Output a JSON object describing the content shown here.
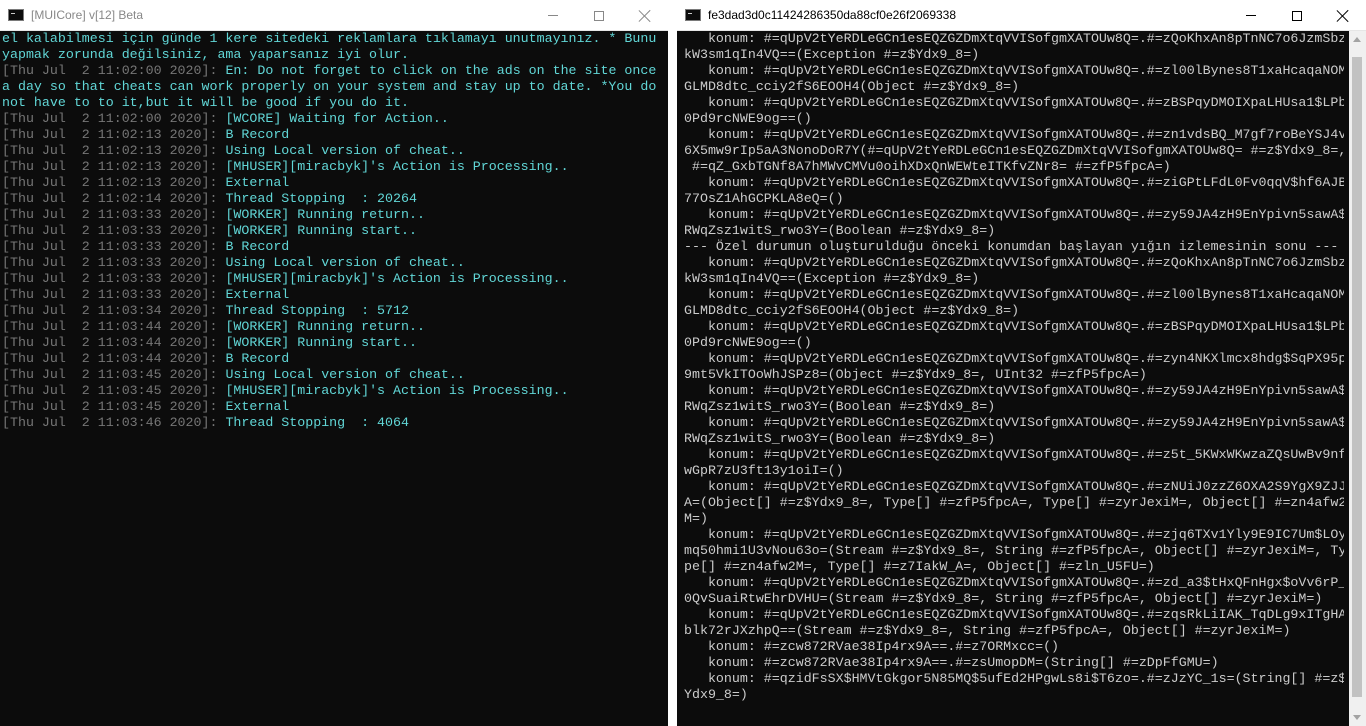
{
  "left_window": {
    "title": "[MUICore] v[12] Beta",
    "colors": {
      "timestamp": "#767676",
      "message": "#61d6d6",
      "background": "#0c0c0c"
    },
    "lines": [
      {
        "ts": "",
        "msg": "el kalabilmesi için günde 1 kere sitedeki reklamlara tıklamayı unutmayınız. * Bunu"
      },
      {
        "ts": "",
        "msg": "yapmak zorunda değilsiniz, ama yaparsanız iyi olur."
      },
      {
        "ts": "[Thu Jul  2 11:02:00 2020]: ",
        "msg": "En: Do not forget to click on the ads on the site once"
      },
      {
        "ts": "",
        "msg": "a day so that cheats can work properly on your system and stay up to date. *You do"
      },
      {
        "ts": "",
        "msg": "not have to to it,but it will be good if you do it."
      },
      {
        "ts": "[Thu Jul  2 11:02:00 2020]: ",
        "msg": "[WCORE] Waiting for Action.."
      },
      {
        "ts": "[Thu Jul  2 11:02:13 2020]: ",
        "msg": "B Record"
      },
      {
        "ts": "[Thu Jul  2 11:02:13 2020]: ",
        "msg": "Using Local version of cheat.."
      },
      {
        "ts": "[Thu Jul  2 11:02:13 2020]: ",
        "msg": "[MHUSER][miracbyk]'s Action is Processing.."
      },
      {
        "ts": "[Thu Jul  2 11:02:13 2020]: ",
        "msg": "External"
      },
      {
        "ts": "[Thu Jul  2 11:02:14 2020]: ",
        "msg": "Thread Stopping  : 20264"
      },
      {
        "ts": "[Thu Jul  2 11:03:33 2020]: ",
        "msg": "[WORKER] Running return.."
      },
      {
        "ts": "[Thu Jul  2 11:03:33 2020]: ",
        "msg": "[WORKER] Running start.."
      },
      {
        "ts": "[Thu Jul  2 11:03:33 2020]: ",
        "msg": "B Record"
      },
      {
        "ts": "[Thu Jul  2 11:03:33 2020]: ",
        "msg": "Using Local version of cheat.."
      },
      {
        "ts": "[Thu Jul  2 11:03:33 2020]: ",
        "msg": "[MHUSER][miracbyk]'s Action is Processing.."
      },
      {
        "ts": "[Thu Jul  2 11:03:33 2020]: ",
        "msg": "External"
      },
      {
        "ts": "[Thu Jul  2 11:03:34 2020]: ",
        "msg": "Thread Stopping  : 5712"
      },
      {
        "ts": "[Thu Jul  2 11:03:44 2020]: ",
        "msg": "[WORKER] Running return.."
      },
      {
        "ts": "[Thu Jul  2 11:03:44 2020]: ",
        "msg": "[WORKER] Running start.."
      },
      {
        "ts": "[Thu Jul  2 11:03:44 2020]: ",
        "msg": "B Record"
      },
      {
        "ts": "[Thu Jul  2 11:03:45 2020]: ",
        "msg": "Using Local version of cheat.."
      },
      {
        "ts": "[Thu Jul  2 11:03:45 2020]: ",
        "msg": "[MHUSER][miracbyk]'s Action is Processing.."
      },
      {
        "ts": "[Thu Jul  2 11:03:45 2020]: ",
        "msg": "External"
      },
      {
        "ts": "[Thu Jul  2 11:03:46 2020]: ",
        "msg": "Thread Stopping  : 4064"
      }
    ]
  },
  "right_window": {
    "title": "fe3dad3d0c11424286350da88cf0e26f2069338",
    "colors": {
      "text": "#cccccc",
      "background": "#0c0c0c",
      "scrollbar_track": "#f0f0f0",
      "scrollbar_thumb": "#c2c2c2"
    },
    "lines": [
      "   konum: #=qUpV2tYeRDLeGCn1esEQZGZDmXtqVVISofgmXATOUw8Q=.#=zQoKhxAn8pTnNC7o6JzmSbz",
      "kW3sm1qIn4VQ==(Exception #=z$Ydx9_8=)",
      "   konum: #=qUpV2tYeRDLeGCn1esEQZGZDmXtqVVISofgmXATOUw8Q=.#=zl00lBynes8T1xaHcaqaNOM",
      "GLMD8dtc_cciy2fS6EOOH4(Object #=z$Ydx9_8=)",
      "   konum: #=qUpV2tYeRDLeGCn1esEQZGZDmXtqVVISofgmXATOUw8Q=.#=zBSPqyDMOIXpaLHUsa1$LPb",
      "0Pd9rcNWE9og==()",
      "   konum: #=qUpV2tYeRDLeGCn1esEQZGZDmXtqVVISofgmXATOUw8Q=.#=zn1vdsBQ_M7gf7roBeYSJ4v",
      "6X5mw9rIp5aA3NonoDoR7Y(#=qUpV2tYeRDLeGCn1esEQZGZDmXtqVVISofgmXATOUw8Q= #=z$Ydx9_8=,",
      " #=qZ_GxbTGNf8A7hMWvCMVu0oihXDxQnWEWteITKfvZNr8= #=zfP5fpcA=)",
      "   konum: #=qUpV2tYeRDLeGCn1esEQZGZDmXtqVVISofgmXATOUw8Q=.#=ziGPtLFdL0Fv0qqV$hf6AJB",
      "77OsZ1AhGCPKLA8eQ=()",
      "   konum: #=qUpV2tYeRDLeGCn1esEQZGZDmXtqVVISofgmXATOUw8Q=.#=zy59JA4zH9EnYpivn5sawA$",
      "RWqZsz1witS_rwo3Y=(Boolean #=z$Ydx9_8=)",
      "--- Özel durumun oluşturulduğu önceki konumdan başlayan yığın izlemesinin sonu ---",
      "   konum: #=qUpV2tYeRDLeGCn1esEQZGZDmXtqVVISofgmXATOUw8Q=.#=zQoKhxAn8pTnNC7o6JzmSbz",
      "kW3sm1qIn4VQ==(Exception #=z$Ydx9_8=)",
      "   konum: #=qUpV2tYeRDLeGCn1esEQZGZDmXtqVVISofgmXATOUw8Q=.#=zl00lBynes8T1xaHcaqaNOM",
      "GLMD8dtc_cciy2fS6EOOH4(Object #=z$Ydx9_8=)",
      "   konum: #=qUpV2tYeRDLeGCn1esEQZGZDmXtqVVISofgmXATOUw8Q=.#=zBSPqyDMOIXpaLHUsa1$LPb",
      "0Pd9rcNWE9og==()",
      "   konum: #=qUpV2tYeRDLeGCn1esEQZGZDmXtqVVISofgmXATOUw8Q=.#=zyn4NKXlmcx8hdg$SqPX95p",
      "9mt5VkITOoWhJSPz8=(Object #=z$Ydx9_8=, UInt32 #=zfP5fpcA=)",
      "   konum: #=qUpV2tYeRDLeGCn1esEQZGZDmXtqVVISofgmXATOUw8Q=.#=zy59JA4zH9EnYpivn5sawA$",
      "RWqZsz1witS_rwo3Y=(Boolean #=z$Ydx9_8=)",
      "   konum: #=qUpV2tYeRDLeGCn1esEQZGZDmXtqVVISofgmXATOUw8Q=.#=zy59JA4zH9EnYpivn5sawA$",
      "RWqZsz1witS_rwo3Y=(Boolean #=z$Ydx9_8=)",
      "   konum: #=qUpV2tYeRDLeGCn1esEQZGZDmXtqVVISofgmXATOUw8Q=.#=z5t_5KWxWKwzaZQsUwBv9nf",
      "wGpR7zU3ft13y1oiI=()",
      "   konum: #=qUpV2tYeRDLeGCn1esEQZGZDmXtqVVISofgmXATOUw8Q=.#=zNUiJ0zzZ6OXA2S9YgX9ZJJ",
      "A=(Object[] #=z$Ydx9_8=, Type[] #=zfP5fpcA=, Type[] #=zyrJexiM=, Object[] #=zn4afw2",
      "M=)",
      "   konum: #=qUpV2tYeRDLeGCn1esEQZGZDmXtqVVISofgmXATOUw8Q=.#=zjq6TXv1Yly9E9IC7Um$LOy",
      "mq50hmi1U3vNou63o=(Stream #=z$Ydx9_8=, String #=zfP5fpcA=, Object[] #=zyrJexiM=, Ty",
      "pe[] #=zn4afw2M=, Type[] #=z7IakW_A=, Object[] #=zln_U5FU=)",
      "   konum: #=qUpV2tYeRDLeGCn1esEQZGZDmXtqVVISofgmXATOUw8Q=.#=zd_a3$tHxQFnHgx$oVv6rP_",
      "0QvSuaiRtwEhrDVHU=(Stream #=z$Ydx9_8=, String #=zfP5fpcA=, Object[] #=zyrJexiM=)",
      "   konum: #=qUpV2tYeRDLeGCn1esEQZGZDmXtqVVISofgmXATOUw8Q=.#=zqsRkLiIAK_TqDLg9xITgHA",
      "blk72rJXzhpQ==(Stream #=z$Ydx9_8=, String #=zfP5fpcA=, Object[] #=zyrJexiM=)",
      "   konum: #=zcw872RVae38Ip4rx9A==.#=z7ORMxcc=()",
      "   konum: #=zcw872RVae38Ip4rx9A==.#=zsUmopDM=(String[] #=zDpFfGMU=)",
      "   konum: #=qzidFsSX$HMVtGkgor5N85MQ$5ufEd2HPgwLs8i$T6zo=.#=zJzYC_1s=(String[] #=z$",
      "Ydx9_8=)"
    ]
  }
}
